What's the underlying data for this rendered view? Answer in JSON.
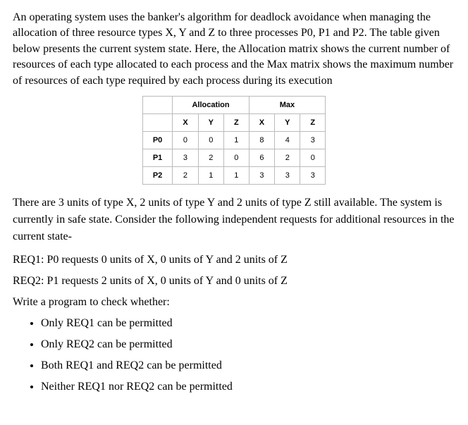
{
  "intro": "An operating system uses the banker's algorithm for deadlock avoidance when managing the allocation of three resource types X, Y and Z to three processes P0, P1 and P2. The table given below presents the current system state. Here, the Allocation matrix shows the current number of resources of each type allocated to each process and the Max matrix shows the maximum number of resources of each type required by each process during its execution",
  "table": {
    "group_headers": [
      "Allocation",
      "Max"
    ],
    "sub_headers": [
      "X",
      "Y",
      "Z",
      "X",
      "Y",
      "Z"
    ],
    "rows": [
      {
        "label": "P0",
        "cells": [
          "0",
          "0",
          "1",
          "8",
          "4",
          "3"
        ]
      },
      {
        "label": "P1",
        "cells": [
          "3",
          "2",
          "0",
          "6",
          "2",
          "0"
        ]
      },
      {
        "label": "P2",
        "cells": [
          "2",
          "1",
          "1",
          "3",
          "3",
          "3"
        ]
      }
    ]
  },
  "after_table": "There are 3 units of type X, 2 units of type Y and 2 units of type Z still available. The system is currently in safe state. Consider the following independent requests for additional resources in the current state-",
  "req1": "REQ1: P0 requests 0 units of X, 0 units of Y and 2 units of Z",
  "req2": "REQ2: P1 requests 2 units of X, 0 units of Y and 0 units of Z",
  "prompt": "Write a program to check whether:",
  "bullets": [
    "Only REQ1 can be permitted",
    "Only REQ2 can be permitted",
    "Both REQ1 and REQ2 can be permitted",
    "Neither REQ1 nor REQ2 can be permitted"
  ]
}
